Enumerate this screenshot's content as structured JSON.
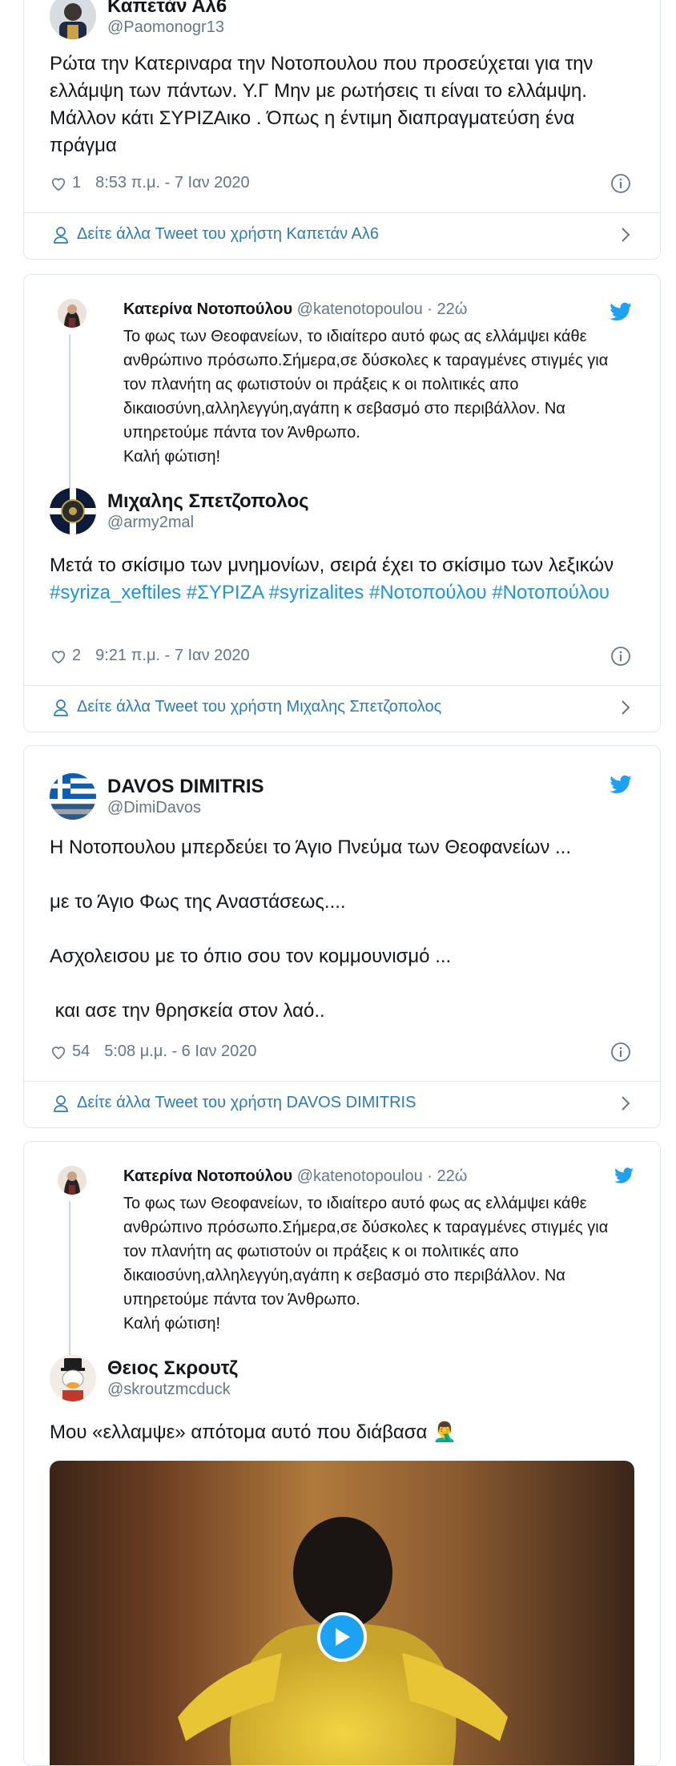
{
  "colors": {
    "link": "#2b7bb9",
    "hashtag": "#1b95e0",
    "muted": "#657786",
    "twitter_blue": "#1da1f2"
  },
  "tweets": [
    {
      "display_name": "Καπετάν Αλ6",
      "handle": "@Paomonogr13",
      "text": "Ρώτα την Κατεριναρα την Νοτοπουλου που προσεύχεται για την ελλάμψη των πάντων. Υ.Γ Μην με ρωτήσεις τι είναι το ελλάμψη. Μάλλον κάτι ΣΥΡΙΖΑικο . Όπως η έντιμη διαπραγματεύση ένα πράγμα",
      "likes": "1",
      "timestamp": "8:53 π.μ. - 7 Ιαν 2020",
      "more_link": "Δείτε άλλα Tweet του χρήστη Καπετάν Αλ6"
    },
    {
      "quote": {
        "display_name": "Κατερίνα Νοτοπούλου",
        "handle": "@katenotopoulou · 22ώ",
        "text": "Το φως των Θεοφανείων, το ιδιαίτερο αυτό φως ας ελλάμψει κάθε ανθρώπινο πρόσωπο.Σήμερα,σε δύσκολες κ ταραγμένες στιγμές για τον πλανήτη ας φωτιστούν οι πράξεις κ οι πολιτικές απο δικαιοσύνη,αλληλεγγύη,αγάπη κ σεβασμό στο περιβάλλον. Να υπηρετούμε πάντα τον Άνθρωπο.\nΚαλή φώτιση!"
      },
      "display_name": "Μιχαλης Σπετζοπολος",
      "handle": "@army2mal",
      "text_plain": "Μετά το σκίσιμο των μνημονίων, σειρά έχει το σκίσιμο των λεξικών ",
      "hashtags": [
        "#syriza_xeftiles",
        "#ΣΥΡΙΖΑ",
        "#syrizalites",
        "#Νοτοπούλου",
        "#Νοτοπούλου"
      ],
      "likes": "2",
      "timestamp": "9:21 π.μ. - 7 Ιαν 2020",
      "more_link": "Δείτε άλλα Tweet του χρήστη Μιχαλης Σπετζοπολος"
    },
    {
      "display_name": "DAVOS DIMITRIS",
      "handle": "@DimiDavos",
      "text": "Η Νοτοπουλου μπερδεύει το Άγιο Πνεύμα των Θεοφανείων ...\n\nμε το Άγιο Φως της Αναστάσεως....\n\nΑσχολεισου με το όπιο σου τον κομμουνισμό ...\n\n και ασε την θρησκεία στον λαό..",
      "likes": "54",
      "timestamp": "5:08 μ.μ. - 6 Ιαν 2020",
      "more_link": "Δείτε άλλα Tweet του χρήστη DAVOS DIMITRIS"
    },
    {
      "quote": {
        "display_name": "Κατερίνα Νοτοπούλου",
        "handle": "@katenotopoulou · 22ώ",
        "text": "Το φως των Θεοφανείων, το ιδιαίτερο αυτό φως ας ελλάμψει κάθε ανθρώπινο πρόσωπο.Σήμερα,σε δύσκολες κ ταραγμένες στιγμές για τον πλανήτη ας φωτιστούν οι πράξεις κ οι πολιτικές απο δικαιοσύνη,αλληλεγγύη,αγάπη κ σεβασμό στο περιβάλλον. Να υπηρετούμε πάντα τον Άνθρωπο.\nΚαλή φώτιση!"
      },
      "display_name": "Θειος Σκρουτζ",
      "handle": "@skroutzmcduck",
      "text": "Μου «ελλαμψε» απότομα αυτό που διάβασα 🤦‍♂️",
      "media": {
        "icon": "play-icon"
      }
    }
  ]
}
